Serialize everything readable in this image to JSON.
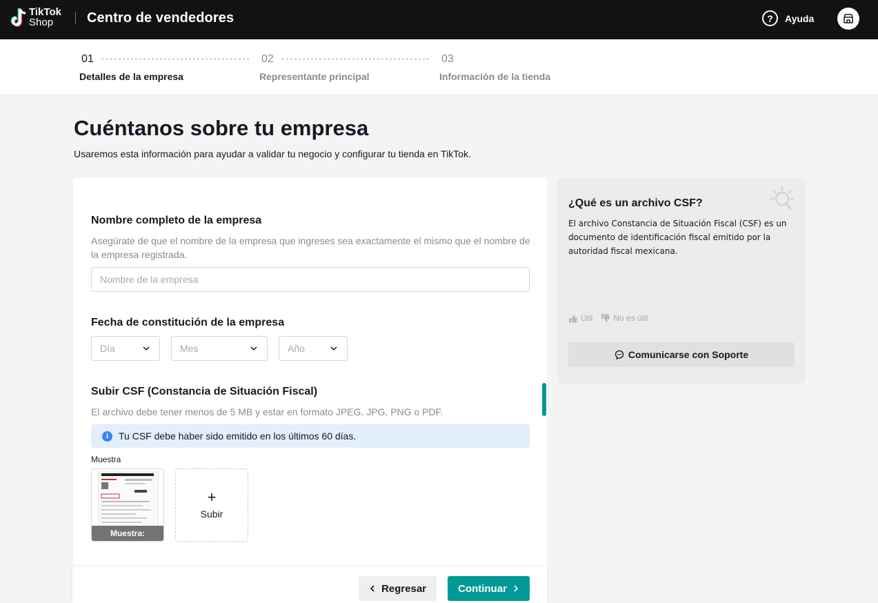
{
  "header": {
    "logo_line1": "TikTok",
    "logo_line2": "Shop",
    "app_title": "Centro de vendedores",
    "help_label": "Ayuda"
  },
  "stepper": {
    "steps": [
      {
        "num": "01",
        "label": "Detalles de la empresa",
        "active": true
      },
      {
        "num": "02",
        "label": "Representante principal",
        "active": false
      },
      {
        "num": "03",
        "label": "Información de la tienda",
        "active": false
      }
    ]
  },
  "page": {
    "title": "Cuéntanos sobre tu empresa",
    "subtitle": "Usaremos esta información para ayudar a validar tu negocio y configurar tu tienda en TikTok."
  },
  "form": {
    "company_name": {
      "label": "Nombre completo de la empresa",
      "help": "Asegúrate de que el nombre de la empresa que ingreses sea exactamente el mismo que el nombre de la empresa registrada.",
      "placeholder": "Nombre de la empresa",
      "value": ""
    },
    "founding_date": {
      "label": "Fecha de constitución de la empresa",
      "day_placeholder": "Día",
      "month_placeholder": "Mes",
      "year_placeholder": "Año"
    },
    "csf": {
      "label": "Subir CSF (Constancia de Situación Fiscal)",
      "help": "El archivo debe tener menos de 5 MB y estar en formato JPEG, JPG, PNG o PDF.",
      "info": "Tu CSF debe haber sido emitido en los últimos 60 días.",
      "sample_label": "Muestra",
      "sample_caption": "Muestra:",
      "upload_label": "Subir"
    }
  },
  "footer": {
    "back_label": "Regresar",
    "next_label": "Continuar"
  },
  "side_panel": {
    "title": "¿Qué es un archivo CSF?",
    "body": "El archivo Constancia de Situación Fiscal (CSF) es un documento de identificación fiscal emitido por la autoridad fiscal mexicana.",
    "useful_label": "Útil",
    "not_useful_label": "No es útil",
    "support_label": "Comunicarse con Soporte"
  },
  "colors": {
    "accent": "#009995",
    "topbar": "#121212",
    "info_bg": "#e3eefc",
    "info_icon": "#3b82f6"
  }
}
